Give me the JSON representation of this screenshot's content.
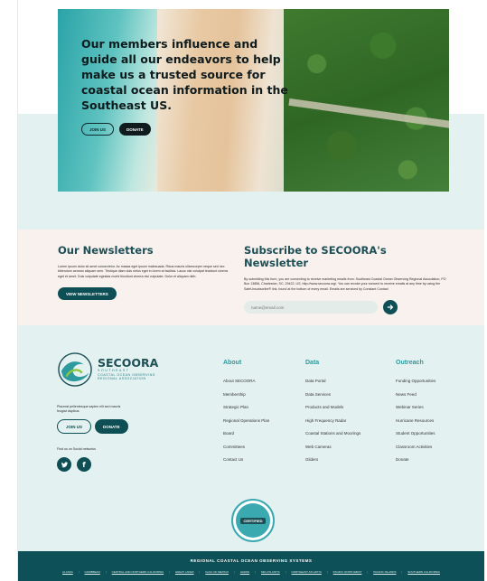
{
  "hero": {
    "title": "Our members influence and guide all our endeavors to help make us a trusted source for coastal ocean information in the Southeast US.",
    "join_label": "JOIN US",
    "donate_label": "DONATE"
  },
  "newsletters": {
    "title": "Our Newsletters",
    "body": "Lorem ipsum dolor sit amet consectetur. Ac massa eget ipsum malesuada. Risus mauris ullamcorper neque sed nec bibendum aenean aliquam sem. Tristique diam duis netus eget in lorem at facilisis. Lacus nisi volutpat tincidunt viverra eget et amet. Duis vulputate egestas morbi tincidunt viverra nisi vulputate. Dolor et aliquam nibh.",
    "button_label": "VIEW NEWSLETTERS"
  },
  "subscribe": {
    "title": "Subscribe to SECOORA's Newsletter",
    "body": "By submitting this form, you are consenting to receive marketing emails from: Southeast Coastal Ocean Observing Regional Association, PO Box 13856, Charleston, SC, 29422, US, http://www.secoora.org/. You can revoke your consent to receive emails at any time by using the SafeUnsubscribe® link, found at the bottom of every email. Emails are serviced by Constant Contact",
    "email_placeholder": "name@email.com"
  },
  "footer": {
    "logo_name": "SECOORA",
    "logo_line1": "SOUTHEAST",
    "logo_line2": "COASTAL OCEAN OBSERVING",
    "logo_line3": "REGIONAL ASSOCIATION",
    "blurb": "Placerat pellentesque sapien elit sed mauris feugiat dapibus.",
    "join_label": "JOIN US",
    "donate_label": "DONATE",
    "social_label": "Find us on Social networks",
    "social": [
      "twitter",
      "facebook"
    ],
    "columns": [
      {
        "title": "About",
        "items": [
          "About SECOORA",
          "Membership",
          "Strategic Plan",
          "Regional Operations Plan",
          "Board",
          "Committees",
          "Contact Us"
        ]
      },
      {
        "title": "Data",
        "items": [
          "Data Portal",
          "Data Services",
          "Products and Models",
          "High Frequency Radar",
          "Coastal Stations and Moorings",
          "Web Cameras",
          "Gliders"
        ]
      },
      {
        "title": "Outreach",
        "items": [
          "Funding Opportunities",
          "News Feed",
          "Webinar Series",
          "Hurricane Resources",
          "Student Opportunities",
          "Classroom Activities",
          "Donate"
        ]
      }
    ],
    "badge_text": "CERTIFIED"
  },
  "bottom": {
    "title": "REGIONAL COASTAL OCEAN OBSERVING SYSTEMS",
    "regions": [
      "ALASKA",
      "CARIBBEAN",
      "CENTRAL AND NORTHERN CALIFORNIA",
      "GREAT LAKES",
      "GULF OF MEXICO",
      "HAWAII",
      "MID-ATLANTIC",
      "NORTHEAST ATLANTIC",
      "PACIFIC NORTHWEST",
      "PACIFIC ISLANDS",
      "SOUTHERN CALIFORNIA"
    ]
  },
  "colors": {
    "brand_dark": "#0d4f55",
    "brand_light": "#2d9aa0",
    "band": "#e3f1f0"
  }
}
